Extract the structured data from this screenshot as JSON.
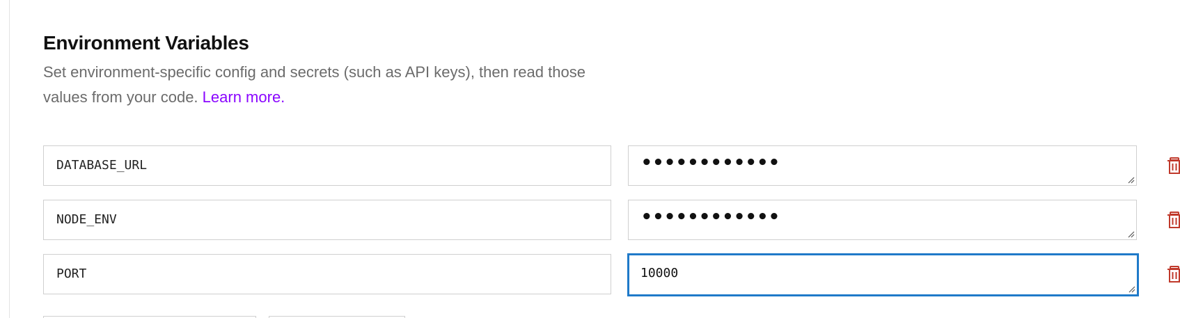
{
  "section": {
    "title": "Environment Variables",
    "description": "Set environment-specific config and secrets (such as API keys), then read those values from your code.",
    "learn_more": "Learn more."
  },
  "env_vars": [
    {
      "key": "DATABASE_URL",
      "value": "••••••••••••",
      "masked": true
    },
    {
      "key": "NODE_ENV",
      "value": "••••••••••••",
      "masked": true
    },
    {
      "key": "PORT",
      "value": "10000",
      "masked": false,
      "focused": true
    }
  ],
  "colors": {
    "accent_link": "#8a05ff",
    "focus_border": "#1f7ac9",
    "delete_icon": "#c0392b"
  },
  "icons": {
    "delete": "trash-icon",
    "resize": "resize-handle-icon"
  }
}
